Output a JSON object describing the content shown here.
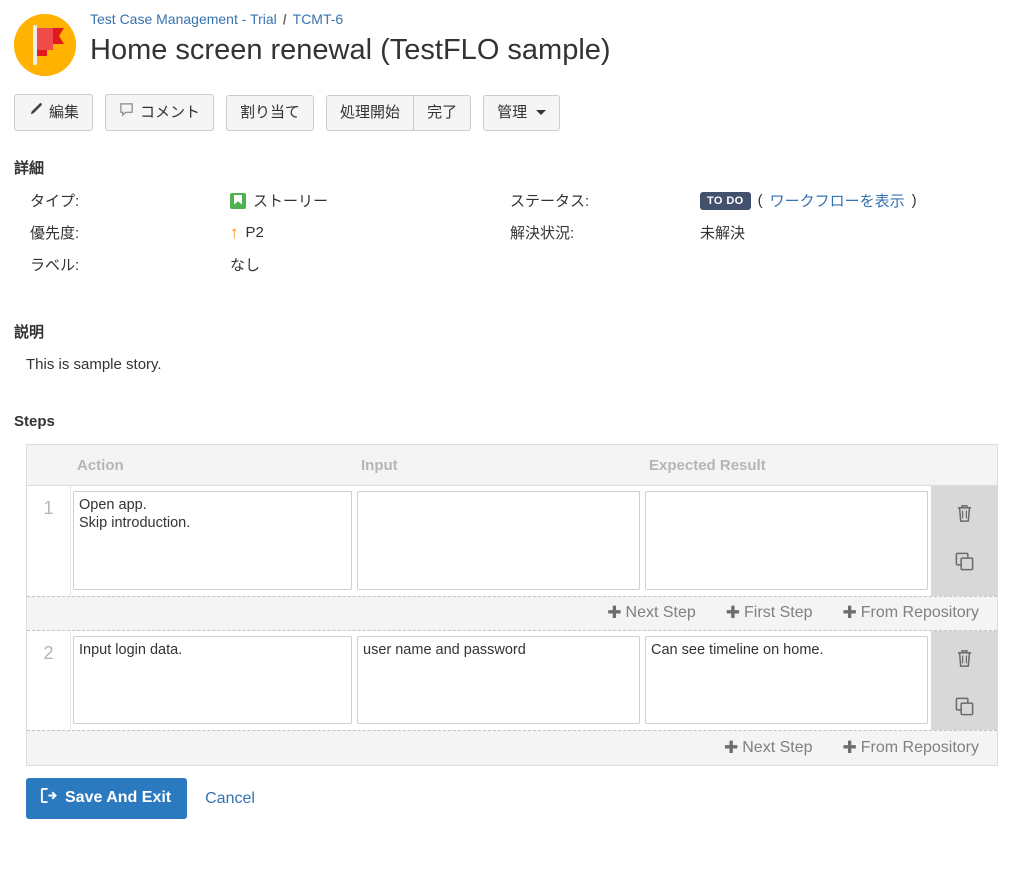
{
  "header": {
    "breadcrumb": {
      "project": "Test Case Management - Trial",
      "separator": "/",
      "issue_key": "TCMT-6"
    },
    "title": "Home screen renewal (TestFLO sample)",
    "avatar_icon": "flag-icon"
  },
  "toolbar": {
    "edit_label": "編集",
    "edit_icon": "pencil-icon",
    "comment_label": "コメント",
    "comment_icon": "speech-bubble-icon",
    "assign_label": "割り当て",
    "start_label": "処理開始",
    "done_label": "完了",
    "manage_label": "管理",
    "manage_caret_icon": "chevron-down-icon"
  },
  "details": {
    "section_title": "詳細",
    "type_label": "タイプ:",
    "type_value": "ストーリー",
    "type_icon": "story-icon",
    "priority_label": "優先度:",
    "priority_value": "P2",
    "priority_icon": "arrow-up-icon",
    "labels_label": "ラベル:",
    "labels_value": "なし",
    "status_label": "ステータス:",
    "status_value": "TO DO",
    "status_color": "#42526e",
    "workflow_link_open": "(",
    "workflow_link": "ワークフローを表示",
    "workflow_link_close": ")",
    "resolution_label": "解決状況:",
    "resolution_value": "未解決"
  },
  "description": {
    "section_title": "説明",
    "body": "This is sample story."
  },
  "steps": {
    "section_title": "Steps",
    "columns": {
      "number": "",
      "action": "Action",
      "input": "Input",
      "expected": "Expected Result"
    },
    "rows": [
      {
        "number": "1",
        "action": "Open app.\nSkip introduction.",
        "input": "",
        "expected": "",
        "delete_icon": "trash-icon",
        "copy_icon": "copy-icon"
      },
      {
        "number": "2",
        "action": "Input login data.",
        "input": "user name and password",
        "expected": "Can see timeline on home.",
        "delete_icon": "trash-icon",
        "copy_icon": "copy-icon"
      }
    ],
    "addbars": [
      {
        "links": [
          "Next Step",
          "First Step",
          "From Repository"
        ]
      },
      {
        "links": [
          "Next Step",
          "From Repository"
        ]
      }
    ]
  },
  "footer": {
    "save_label": "Save And Exit",
    "save_icon": "sign-out-icon",
    "save_color": "#2b7ac0",
    "cancel_label": "Cancel"
  }
}
